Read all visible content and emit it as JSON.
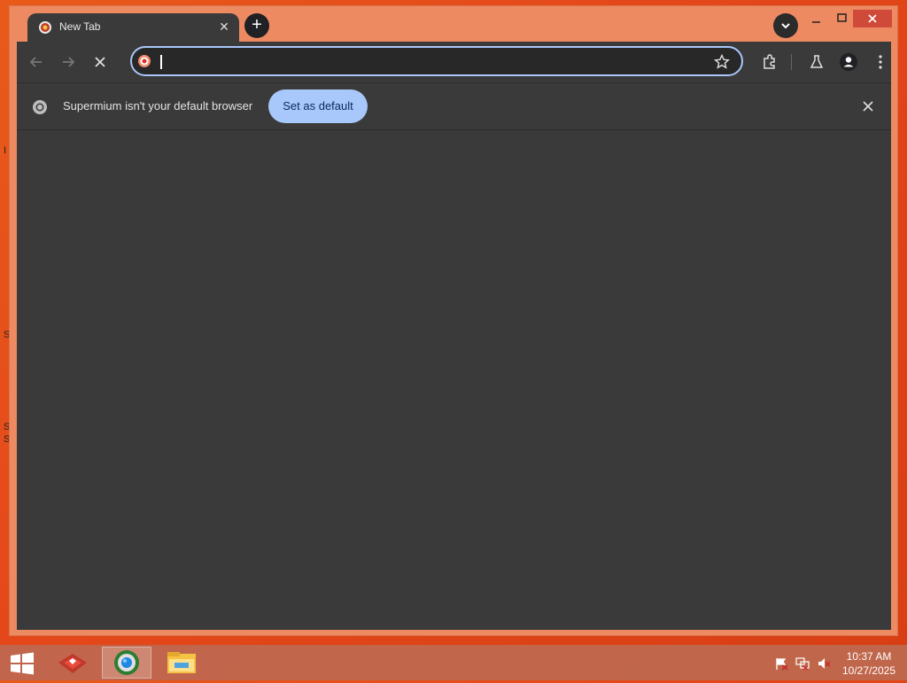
{
  "desktop": {
    "edge_glyphs": [
      "I",
      "S",
      "S",
      "S"
    ]
  },
  "browser": {
    "tab": {
      "title": "New Tab"
    },
    "toolbar": {
      "omnibox_value": "",
      "omnibox_placeholder": ""
    },
    "infobar": {
      "message": "Supermium isn't your default browser",
      "button_label": "Set as default"
    },
    "colors": {
      "window_frame": "#ee8a62",
      "toolbar": "#3a3a3a",
      "accent_blue": "#a8c7fa"
    }
  },
  "taskbar": {
    "clock_time": "10:37 AM",
    "clock_date": "10/27/2025",
    "items": [
      "start-icon",
      "game-icon",
      "browser-icon",
      "file-explorer-icon"
    ],
    "tray_icons": [
      "action-center-flag-icon",
      "network-icon",
      "speaker-muted-icon"
    ]
  }
}
